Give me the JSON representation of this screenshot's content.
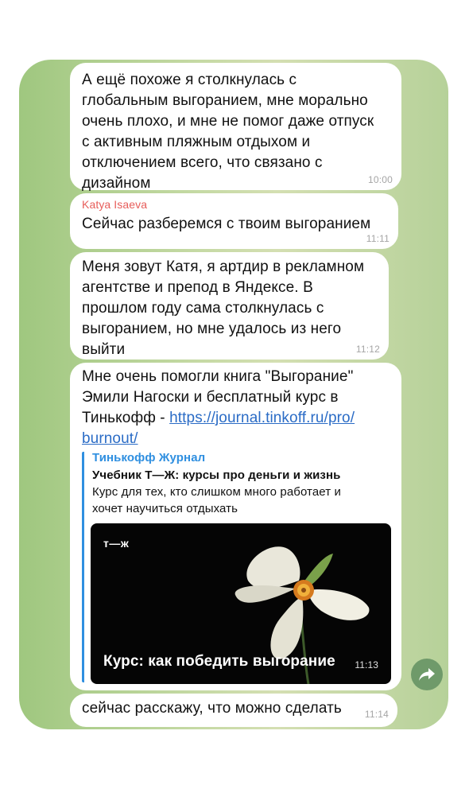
{
  "messages": [
    {
      "text": "А ещё похоже я столкнулась с\nглобальным выгоранием, мне морально\nочень плохо, и мне не помог даже отпуск\nс активным пляжным отдыхом и\nотключением всего, что связано с\nдизайном",
      "time": "10:00"
    },
    {
      "sender": "Katya Isaeva",
      "text": "Сейчас разберемся с твоим выгоранием",
      "time": "11:11"
    },
    {
      "text": "Меня зовут Катя, я артдир в рекламном\nагентстве и препод в Яндексе. В\nпрошлом году сама столкнулась с\nвыгоранием, но мне удалось из него\nвыйти",
      "time": "11:12"
    },
    {
      "text": "Мне очень помогли книга \"Выгорание\"\nЭмили Нагоски и бесплатный курс в\nТинькофф - ",
      "link_part1": "https://journal.tinkoff.ru/pro/",
      "link_part2": "burnout/",
      "preview": {
        "site": "Тинькофф Журнал",
        "title": "Учебник Т—Ж: курсы про деньги и жизнь",
        "description": "Курс для тех, кто слишком много работает и\nхочет научиться отдыхать",
        "image_logo": "т—ж",
        "image_caption": "Курс: как победить выгорание"
      },
      "time": "11:13"
    },
    {
      "text": "сейчас расскажу, что можно сделать",
      "time": "11:14"
    }
  ],
  "colors": {
    "sender": "#e75d5a",
    "link": "#2b6cc6",
    "preview_accent": "#2f8fe0",
    "share_button": "#6f9a6a"
  },
  "icons": {
    "share": "share-arrow-icon"
  }
}
